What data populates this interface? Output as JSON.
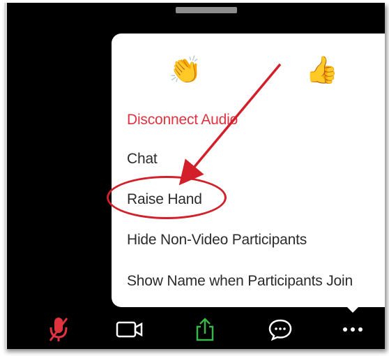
{
  "menu": {
    "reactions": [
      {
        "icon": "clapping-hands-icon",
        "glyph": "👏"
      },
      {
        "icon": "thumbs-up-icon",
        "glyph": "👍"
      }
    ],
    "items": [
      {
        "label": "Disconnect Audio",
        "color": "#e0323f"
      },
      {
        "label": "Chat"
      },
      {
        "label": "Raise Hand"
      },
      {
        "label": "Hide Non-Video Participants"
      },
      {
        "label": "Show Name when Participants Join"
      }
    ]
  },
  "toolbar": {
    "buttons": [
      {
        "icon": "muted-microphone-icon",
        "color": "#e0323f"
      },
      {
        "icon": "video-camera-icon",
        "color": "#ffffff"
      },
      {
        "icon": "share-screen-icon",
        "color": "#3bb54a"
      },
      {
        "icon": "chat-bubble-icon",
        "color": "#ffffff"
      },
      {
        "icon": "more-options-icon",
        "color": "#ffffff"
      }
    ]
  },
  "annotation": {
    "arrow_color": "#d21f2a",
    "highlight_target": "Raise Hand"
  }
}
